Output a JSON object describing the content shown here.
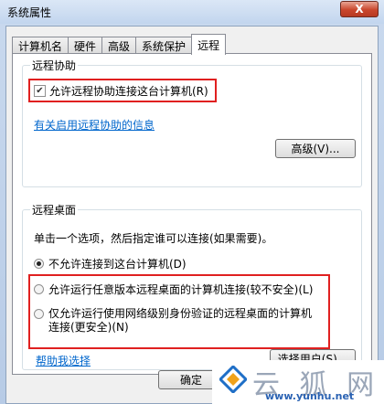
{
  "window": {
    "title": "系统属性",
    "close_label": "X"
  },
  "tabs": [
    {
      "label": "计算机名",
      "active": false
    },
    {
      "label": "硬件",
      "active": false
    },
    {
      "label": "高级",
      "active": false
    },
    {
      "label": "系统保护",
      "active": false
    },
    {
      "label": "远程",
      "active": true
    }
  ],
  "remote_assistance": {
    "title": "远程协助",
    "allow_checkbox_label": "允许远程协助连接这台计算机(R)",
    "allow_checked": true,
    "info_link": "有关启用远程协助的信息",
    "advanced_button": "高级(V)..."
  },
  "remote_desktop": {
    "title": "远程桌面",
    "instruction": "单击一个选项，然后指定谁可以连接(如果需要)。",
    "options": [
      {
        "label": "不允许连接到这台计算机(D)",
        "selected": true
      },
      {
        "label": "允许运行任意版本远程桌面的计算机连接(较不安全)(L)",
        "selected": false
      },
      {
        "label": "仅允许运行使用网络级别身份验证的远程桌面的计算机连接(更安全)(N)",
        "selected": false
      }
    ],
    "help_link": "帮助我选择",
    "select_users_button": "选择用户(S)..."
  },
  "footer": {
    "ok_button": "确定"
  },
  "watermark": {
    "chars": "云 狐 网",
    "url": "www.yunhu.net"
  }
}
